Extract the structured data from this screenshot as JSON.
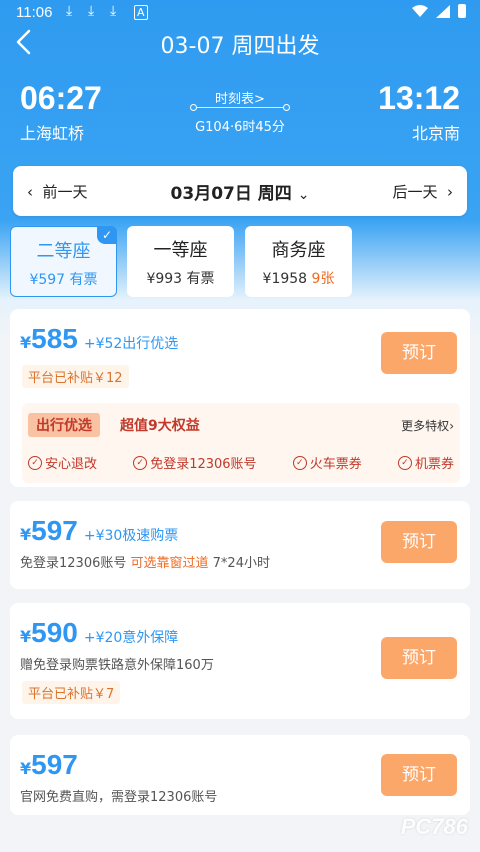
{
  "status": {
    "time": "11:06",
    "download_icons": [
      "download-icon",
      "download-icon",
      "download-icon",
      "app-notification-icon"
    ]
  },
  "nav": {
    "title": "03-07 周四出发"
  },
  "route": {
    "dep_time": "06:27",
    "dep_station": "上海虹桥",
    "arr_time": "13:12",
    "arr_station": "北京南",
    "schedule_link": "时刻表>",
    "train_info": "G104·6时45分"
  },
  "datebar": {
    "prev": "前一天",
    "current": "03月07日 周四",
    "next": "后一天"
  },
  "seats": [
    {
      "name": "二等座",
      "price": "¥597",
      "avail": "有票",
      "selected": true
    },
    {
      "name": "一等座",
      "price": "¥993",
      "avail": "有票",
      "selected": false
    },
    {
      "name": "商务座",
      "price": "¥1958",
      "avail": "9张",
      "selected": false
    }
  ],
  "offers": [
    {
      "yen": "¥",
      "amount": "585",
      "extra": "+¥52出行优选",
      "subsidy": "平台已补贴￥12",
      "book": "预订",
      "benefit": {
        "tag": "出行优选",
        "title": "超值9大权益",
        "more": "更多特权",
        "items": [
          "安心退改",
          "免登录12306账号",
          "火车票券",
          "机票券"
        ]
      }
    },
    {
      "yen": "¥",
      "amount": "597",
      "extra": "+¥30极速购票",
      "line_a": "免登录12306账号 ",
      "line_hl": "可选靠窗过道",
      "line_b": " 7*24小时",
      "book": "预订"
    },
    {
      "yen": "¥",
      "amount": "590",
      "extra": "+¥20意外保障",
      "line": "赠免登录购票铁路意外保障160万",
      "subsidy": "平台已补贴￥7",
      "book": "预订"
    },
    {
      "yen": "¥",
      "amount": "597",
      "line": "官网免费直购，需登录12306账号",
      "book": "预订"
    }
  ],
  "colors": {
    "primary": "#2f97f2",
    "book_button": "#fca76a",
    "warning": "#f06a21",
    "benefit_red": "#c0392b"
  },
  "watermark": "PC786"
}
